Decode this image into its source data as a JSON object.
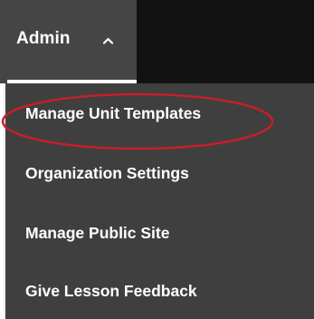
{
  "nav": {
    "admin_label": "Admin",
    "admin_icon": "chevron-up-icon"
  },
  "menu": {
    "items": [
      {
        "label": "Organization Settings",
        "highlighted": true
      },
      {
        "label": "Manage Public Site"
      },
      {
        "label": "Give Lesson Feedback"
      },
      {
        "label": "Manage Unit Templates"
      }
    ]
  },
  "colors": {
    "topbar_background": "#121212",
    "admin_tab_background": "#454545",
    "dropdown_background": "#3f3f3f",
    "text": "#ffffff",
    "annotation_circle": "#c41f2a"
  }
}
